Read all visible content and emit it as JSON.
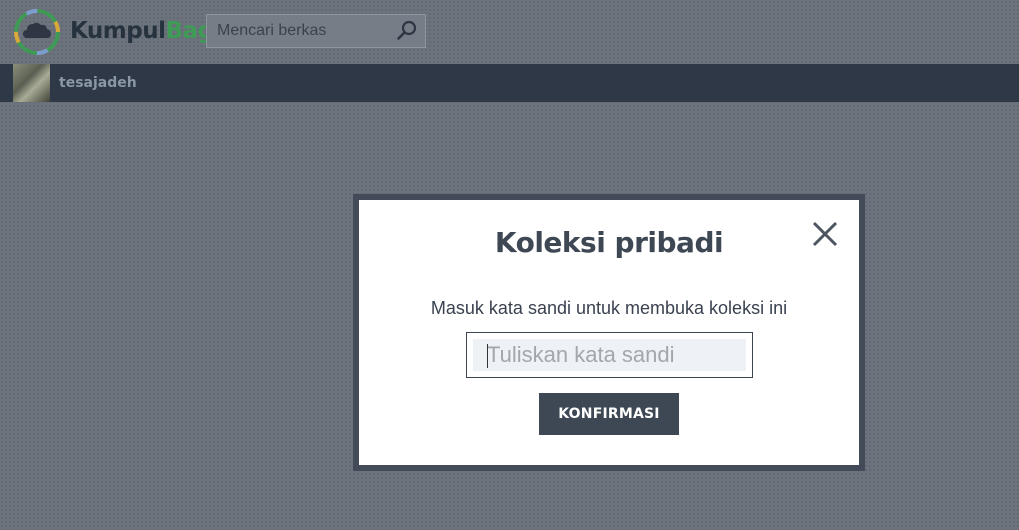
{
  "header": {
    "brand_part1": "Kumpul",
    "brand_part2": "Bagi",
    "search_placeholder": "Mencari berkas"
  },
  "userbar": {
    "username": "tesajadeh"
  },
  "modal": {
    "title": "Koleksi pribadi",
    "message": "Masuk kata sandi untuk membuka koleksi ini",
    "password_placeholder": "Tuliskan kata sandi",
    "password_value": "",
    "confirm_label": "KONFIRMASI"
  },
  "icons": {
    "logo": "cloud-ring-logo-icon",
    "search": "search-icon",
    "close": "close-icon"
  },
  "colors": {
    "brand_dark": "#27323f",
    "brand_green": "#3f9a55",
    "userbar_bg": "#2e3846",
    "button_bg": "#3e4754",
    "overlay_bg": "#6c737d"
  }
}
